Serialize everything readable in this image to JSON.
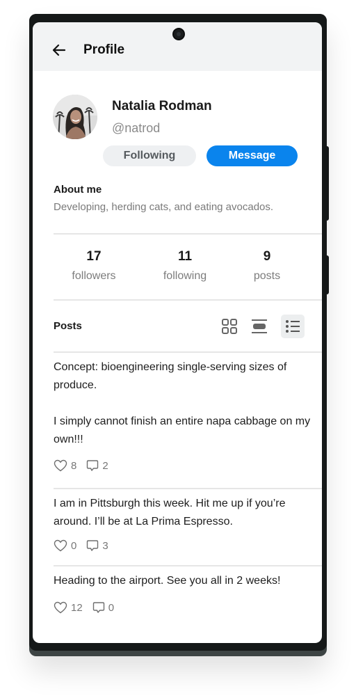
{
  "header": {
    "title": "Profile",
    "back_icon": "arrow-left-icon"
  },
  "profile": {
    "name": "Natalia Rodman",
    "handle": "@natrod",
    "avatar_description": "photo of smiling woman with palm trees",
    "following_button": "Following",
    "message_button": "Message"
  },
  "about": {
    "title": "About me",
    "text": "Developing, herding cats, and eating avocados."
  },
  "stats": [
    {
      "value": "17",
      "label": "followers"
    },
    {
      "value": "11",
      "label": "following"
    },
    {
      "value": "9",
      "label": "posts"
    }
  ],
  "posts_section": {
    "title": "Posts",
    "view_modes": [
      {
        "name": "grid-view",
        "icon": "grid-icon",
        "active": false
      },
      {
        "name": "card-view",
        "icon": "card-icon",
        "active": false
      },
      {
        "name": "list-view",
        "icon": "list-icon",
        "active": true
      }
    ]
  },
  "posts": [
    {
      "text": "Concept: bioengineering single-serving sizes of produce.\n\nI simply cannot finish an entire napa cabbage on my own!!!",
      "likes": "8",
      "comments": "2"
    },
    {
      "text": "I am in Pittsburgh this week. Hit me up if you’re around. I’ll be at La Prima Espresso.",
      "likes": "0",
      "comments": "3"
    },
    {
      "text": "Heading to the airport. See you all in 2 weeks!",
      "likes": "12",
      "comments": "0"
    }
  ],
  "colors": {
    "accent": "#0a84ed",
    "appbar_bg": "#f2f3f4",
    "device_frame": "#151818"
  }
}
